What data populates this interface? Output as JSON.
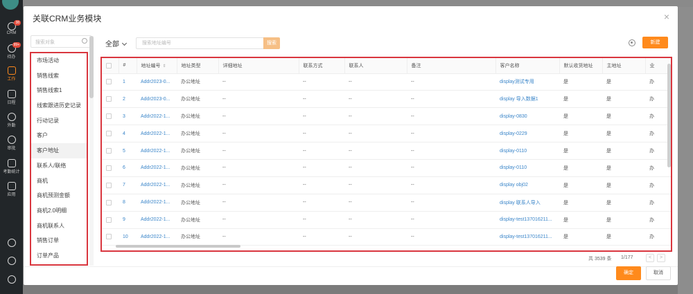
{
  "appnav": {
    "items": [
      {
        "label": "CRM",
        "badge": "38",
        "icon": "crm-icon"
      },
      {
        "label": "待办",
        "badge": "99+",
        "icon": "check-icon"
      },
      {
        "label": "工作",
        "badge": "",
        "icon": "briefcase-icon"
      },
      {
        "label": "日程",
        "badge": "",
        "icon": "calendar-icon"
      },
      {
        "label": "外勤",
        "badge": "",
        "icon": "location-icon"
      },
      {
        "label": "审批",
        "badge": "",
        "icon": "approval-icon"
      },
      {
        "label": "考勤统计",
        "badge": "",
        "icon": "attendance-icon"
      },
      {
        "label": "应用",
        "badge": "",
        "icon": "apps-icon"
      }
    ]
  },
  "dialog": {
    "title": "关联CRM业务模块",
    "close_label": "×",
    "left_search_placeholder": "搜索对象",
    "modules": [
      "市场活动",
      "销售线索",
      "销售线索1",
      "线索跟进历史记录",
      "行动记录",
      "客户",
      "客户地址",
      "联系人/联络",
      "商机",
      "商机预测金额",
      "商机2.0明细",
      "商机联系人",
      "销售订单",
      "订单产品"
    ],
    "active_module_index": 6,
    "filter_label": "全部",
    "search_placeholder": "搜索地址编号",
    "search_button": "搜索",
    "new_button": "新建",
    "columns": [
      "#",
      "地址编号",
      "地址类型",
      "详细地址",
      "联系方式",
      "联系人",
      "备注",
      "客户名称",
      "默认收货地址",
      "主地址",
      "业"
    ],
    "rows": [
      [
        "1",
        "Addr2023-0...",
        "办公地址",
        "--",
        "--",
        "--",
        "--",
        "display测试专用",
        "是",
        "是",
        "办"
      ],
      [
        "2",
        "Addr2023-0...",
        "办公地址",
        "--",
        "--",
        "--",
        "--",
        "display 导入数据1",
        "是",
        "是",
        "办"
      ],
      [
        "3",
        "Addr2022-1...",
        "办公地址",
        "--",
        "--",
        "--",
        "--",
        "display-0830",
        "是",
        "是",
        "办"
      ],
      [
        "4",
        "Addr2022-1...",
        "办公地址",
        "--",
        "--",
        "--",
        "--",
        "display-0229",
        "是",
        "是",
        "办"
      ],
      [
        "5",
        "Addr2022-1...",
        "办公地址",
        "--",
        "--",
        "--",
        "--",
        "display-0110",
        "是",
        "是",
        "办"
      ],
      [
        "6",
        "Addr2022-1...",
        "办公地址",
        "--",
        "--",
        "--",
        "--",
        "display-0110",
        "是",
        "是",
        "办"
      ],
      [
        "7",
        "Addr2022-1...",
        "办公地址",
        "--",
        "--",
        "--",
        "--",
        "display obj02",
        "是",
        "是",
        "办"
      ],
      [
        "8",
        "Addr2022-1...",
        "办公地址",
        "--",
        "--",
        "--",
        "--",
        "display 联系人导入",
        "是",
        "是",
        "办"
      ],
      [
        "9",
        "Addr2022-1...",
        "办公地址",
        "--",
        "--",
        "--",
        "--",
        "display-test137016211...",
        "是",
        "是",
        "办"
      ],
      [
        "10",
        "Addr2022-1...",
        "办公地址",
        "--",
        "--",
        "--",
        "--",
        "display-test137016211...",
        "是",
        "是",
        "办"
      ]
    ],
    "total_label": "共 3539 条",
    "pager_label": "1/177",
    "prev_label": "<",
    "next_label": ">",
    "ok_button": "确定",
    "cancel_button": "取消"
  },
  "colors": {
    "accent": "#ff8a1c",
    "highlight": "#d9363e",
    "link": "#3a85c9"
  }
}
